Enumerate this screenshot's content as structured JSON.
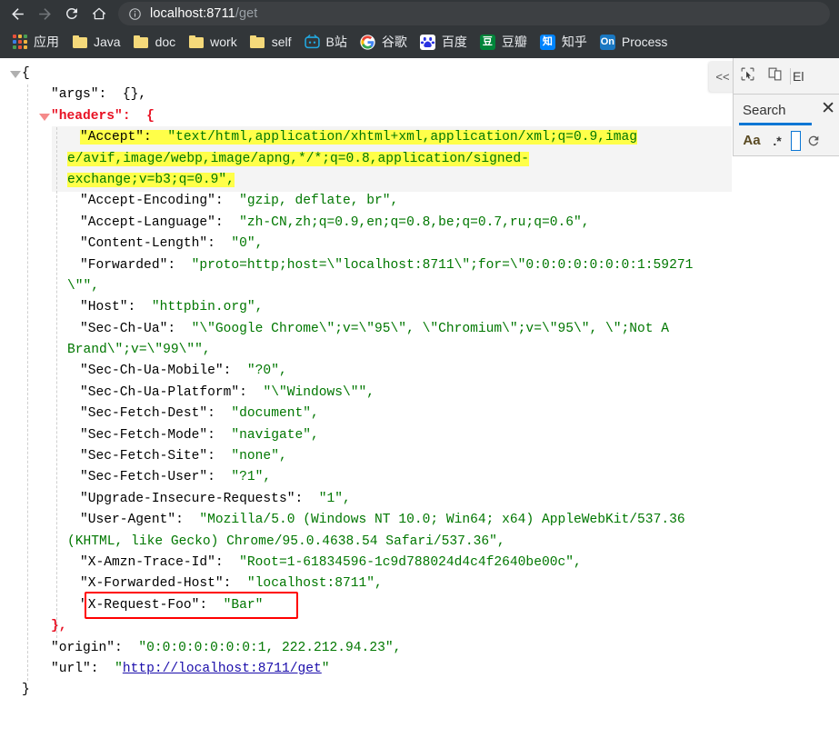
{
  "browser": {
    "nav": {
      "back": "back-arrow",
      "forward": "forward-arrow",
      "reload": "reload-icon",
      "home": "home-icon"
    },
    "omnibox": {
      "info_icon": "page-info-icon",
      "url_host": "localhost:8711",
      "url_path": "/get",
      "url_full": "localhost:8711/get"
    },
    "bookmarks": [
      {
        "label": "应用",
        "icon": "apps-grid-icon",
        "type": "apps"
      },
      {
        "label": "Java",
        "icon": "folder-icon",
        "type": "folder"
      },
      {
        "label": "doc",
        "icon": "folder-icon",
        "type": "folder"
      },
      {
        "label": "work",
        "icon": "folder-icon",
        "type": "folder"
      },
      {
        "label": "self",
        "icon": "folder-icon",
        "type": "folder"
      },
      {
        "label": "B站",
        "icon": "bilibili-icon",
        "type": "site",
        "color": "#22a8e0"
      },
      {
        "label": "谷歌",
        "icon": "google-icon",
        "type": "site",
        "color": "#ffffff"
      },
      {
        "label": "百度",
        "icon": "baidu-icon",
        "type": "site",
        "color": "#2932e1"
      },
      {
        "label": "豆瓣",
        "icon": "douban-icon",
        "type": "site",
        "color": "#00853a",
        "glyph": "豆"
      },
      {
        "label": "知乎",
        "icon": "zhihu-icon",
        "type": "site",
        "color": "#0084ff",
        "glyph": "知"
      },
      {
        "label": "Process",
        "icon": "process-on-icon",
        "type": "site",
        "color": "#1a78c2",
        "glyph": "On"
      }
    ]
  },
  "devtools": {
    "collapse_label": "<<",
    "cursor_icon": "inspect-cursor-icon",
    "device_icon": "device-toolbar-icon",
    "elements_label": "El",
    "find": {
      "tab_label": "Search",
      "close_label": "✕",
      "match_case_label": "Aa",
      "regex_label": ".*",
      "input_value": "",
      "refresh_icon": "refresh-icon"
    }
  },
  "json_body": {
    "lines": [
      {
        "id": "l1",
        "indent": 0,
        "fold": "root",
        "segs": [
          {
            "t": "{",
            "c": "punct"
          }
        ]
      },
      {
        "id": "l2",
        "indent": 1,
        "segs": [
          {
            "t": "\"args\":",
            "c": "k"
          },
          {
            "t": "  ",
            "c": "punct"
          },
          {
            "t": "{},",
            "c": "punct"
          }
        ]
      },
      {
        "id": "l3",
        "indent": 1,
        "fold": "hl",
        "segs": [
          {
            "t": "\"headers\":",
            "c": "k-red"
          },
          {
            "t": "  ",
            "c": "punct"
          },
          {
            "t": "{",
            "c": "k-red"
          }
        ]
      },
      {
        "id": "l4",
        "indent": 2,
        "hl": true,
        "segs": [
          {
            "t": "\"Accept\":",
            "c": "k hl-yellow"
          },
          {
            "t": "  ",
            "c": "punct hl-yellow"
          },
          {
            "t": "\"text/html,application/xhtml+xml,application/xml;q=0.9,imag",
            "c": "v hl-yellow"
          }
        ]
      },
      {
        "id": "l5",
        "indent": 2,
        "cont": true,
        "hl": true,
        "segs": [
          {
            "t": "e/avif,image/webp,image/apng,*/*;q=0.8,application/signed-",
            "c": "v hl-yellow"
          }
        ]
      },
      {
        "id": "l6",
        "indent": 2,
        "cont": true,
        "hl": true,
        "segs": [
          {
            "t": "exchange;v=b3;q=0.9\",",
            "c": "v hl-yellow"
          }
        ]
      },
      {
        "id": "l7",
        "indent": 2,
        "segs": [
          {
            "t": "\"Accept-Encoding\":",
            "c": "k"
          },
          {
            "t": "  ",
            "c": "punct"
          },
          {
            "t": "\"gzip, deflate, br\",",
            "c": "v"
          }
        ]
      },
      {
        "id": "l8",
        "indent": 2,
        "segs": [
          {
            "t": "\"Accept-Language\":",
            "c": "k"
          },
          {
            "t": "  ",
            "c": "punct"
          },
          {
            "t": "\"zh-CN,zh;q=0.9,en;q=0.8,be;q=0.7,ru;q=0.6\",",
            "c": "v"
          }
        ]
      },
      {
        "id": "l9",
        "indent": 2,
        "segs": [
          {
            "t": "\"Content-Length\":",
            "c": "k"
          },
          {
            "t": "  ",
            "c": "punct"
          },
          {
            "t": "\"0\",",
            "c": "v"
          }
        ]
      },
      {
        "id": "l10",
        "indent": 2,
        "segs": [
          {
            "t": "\"Forwarded\":",
            "c": "k"
          },
          {
            "t": "  ",
            "c": "punct"
          },
          {
            "t": "\"proto=http;host=\\\"localhost:8711\\\";for=\\\"0:0:0:0:0:0:0:1:59271",
            "c": "v"
          }
        ]
      },
      {
        "id": "l11",
        "indent": 2,
        "cont": true,
        "segs": [
          {
            "t": "\\\"\",",
            "c": "v"
          }
        ]
      },
      {
        "id": "l12",
        "indent": 2,
        "segs": [
          {
            "t": "\"Host\":",
            "c": "k"
          },
          {
            "t": "  ",
            "c": "punct"
          },
          {
            "t": "\"httpbin.org\",",
            "c": "v"
          }
        ]
      },
      {
        "id": "l13",
        "indent": 2,
        "segs": [
          {
            "t": "\"Sec-Ch-Ua\":",
            "c": "k"
          },
          {
            "t": "  ",
            "c": "punct"
          },
          {
            "t": "\"\\\"Google Chrome\\\";v=\\\"95\\\", \\\"Chromium\\\";v=\\\"95\\\", \\\";Not A",
            "c": "v"
          }
        ]
      },
      {
        "id": "l14",
        "indent": 2,
        "cont": true,
        "segs": [
          {
            "t": "Brand\\\";v=\\\"99\\\"\",",
            "c": "v"
          }
        ]
      },
      {
        "id": "l15",
        "indent": 2,
        "segs": [
          {
            "t": "\"Sec-Ch-Ua-Mobile\":",
            "c": "k"
          },
          {
            "t": "  ",
            "c": "punct"
          },
          {
            "t": "\"?0\",",
            "c": "v"
          }
        ]
      },
      {
        "id": "l16",
        "indent": 2,
        "segs": [
          {
            "t": "\"Sec-Ch-Ua-Platform\":",
            "c": "k"
          },
          {
            "t": "  ",
            "c": "punct"
          },
          {
            "t": "\"\\\"Windows\\\"\",",
            "c": "v"
          }
        ]
      },
      {
        "id": "l17",
        "indent": 2,
        "segs": [
          {
            "t": "\"Sec-Fetch-Dest\":",
            "c": "k"
          },
          {
            "t": "  ",
            "c": "punct"
          },
          {
            "t": "\"document\",",
            "c": "v"
          }
        ]
      },
      {
        "id": "l18",
        "indent": 2,
        "segs": [
          {
            "t": "\"Sec-Fetch-Mode\":",
            "c": "k"
          },
          {
            "t": "  ",
            "c": "punct"
          },
          {
            "t": "\"navigate\",",
            "c": "v"
          }
        ]
      },
      {
        "id": "l19",
        "indent": 2,
        "segs": [
          {
            "t": "\"Sec-Fetch-Site\":",
            "c": "k"
          },
          {
            "t": "  ",
            "c": "punct"
          },
          {
            "t": "\"none\",",
            "c": "v"
          }
        ]
      },
      {
        "id": "l20",
        "indent": 2,
        "segs": [
          {
            "t": "\"Sec-Fetch-User\":",
            "c": "k"
          },
          {
            "t": "  ",
            "c": "punct"
          },
          {
            "t": "\"?1\",",
            "c": "v"
          }
        ]
      },
      {
        "id": "l21",
        "indent": 2,
        "segs": [
          {
            "t": "\"Upgrade-Insecure-Requests\":",
            "c": "k"
          },
          {
            "t": "  ",
            "c": "punct"
          },
          {
            "t": "\"1\",",
            "c": "v"
          }
        ]
      },
      {
        "id": "l22",
        "indent": 2,
        "segs": [
          {
            "t": "\"User-Agent\":",
            "c": "k"
          },
          {
            "t": "  ",
            "c": "punct"
          },
          {
            "t": "\"Mozilla/5.0 (Windows NT 10.0; Win64; x64) AppleWebKit/537.36",
            "c": "v"
          }
        ]
      },
      {
        "id": "l23",
        "indent": 2,
        "cont": true,
        "segs": [
          {
            "t": "(KHTML, like Gecko) Chrome/95.0.4638.54 Safari/537.36\",",
            "c": "v"
          }
        ]
      },
      {
        "id": "l24",
        "indent": 2,
        "segs": [
          {
            "t": "\"X-Amzn-Trace-Id\":",
            "c": "k"
          },
          {
            "t": "  ",
            "c": "punct"
          },
          {
            "t": "\"Root=1-61834596-1c9d788024d4c4f2640be00c\",",
            "c": "v"
          }
        ]
      },
      {
        "id": "l25",
        "indent": 2,
        "segs": [
          {
            "t": "\"X-Forwarded-Host\":",
            "c": "k"
          },
          {
            "t": "  ",
            "c": "punct"
          },
          {
            "t": "\"localhost:8711\",",
            "c": "v"
          }
        ]
      },
      {
        "id": "l26",
        "indent": 2,
        "boxed": true,
        "segs": [
          {
            "t": "\"X-Request-Foo\":",
            "c": "k"
          },
          {
            "t": "  ",
            "c": "punct"
          },
          {
            "t": "\"Bar\"",
            "c": "v"
          }
        ]
      },
      {
        "id": "l27",
        "indent": 1,
        "segs": [
          {
            "t": "},",
            "c": "punct-red"
          }
        ]
      },
      {
        "id": "l28",
        "indent": 1,
        "segs": [
          {
            "t": "\"origin\":",
            "c": "k"
          },
          {
            "t": "  ",
            "c": "punct"
          },
          {
            "t": "\"0:0:0:0:0:0:0:1, 222.212.94.23\",",
            "c": "v"
          }
        ]
      },
      {
        "id": "l29",
        "indent": 1,
        "segs": [
          {
            "t": "\"url\":",
            "c": "k"
          },
          {
            "t": "  ",
            "c": "punct"
          },
          {
            "t": "\"",
            "c": "v"
          },
          {
            "t": "http://localhost:8711/get",
            "c": "link"
          },
          {
            "t": "\"",
            "c": "v"
          }
        ]
      },
      {
        "id": "l30",
        "indent": 0,
        "segs": [
          {
            "t": "}",
            "c": "punct"
          }
        ]
      }
    ]
  }
}
